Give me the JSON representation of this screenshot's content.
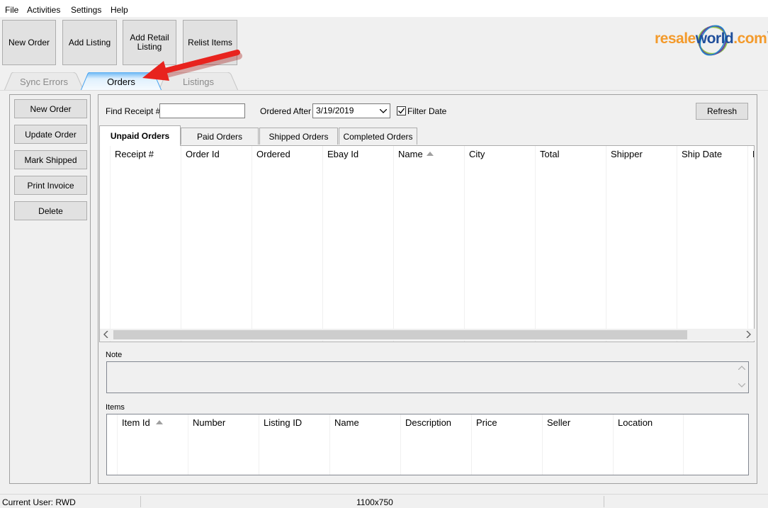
{
  "menu": {
    "file": "File",
    "activities": "Activities",
    "settings": "Settings",
    "help": "Help"
  },
  "toolbar": {
    "new_order": "New Order",
    "add_listing": "Add Listing",
    "add_retail_listing_line1": "Add Retail",
    "add_retail_listing_line2": "Listing",
    "relist_items": "Relist Items"
  },
  "logo": {
    "resale": "resale",
    "world": "world",
    "com": ".com",
    "tm": "™",
    "colors": {
      "resale": "#f39a2b",
      "world": "#1f4e9b",
      "com": "#f39a2b"
    }
  },
  "top_tabs": {
    "sync_errors": "Sync Errors",
    "orders": "Orders",
    "listings": "Listings",
    "active_color": "#47a3f0"
  },
  "sidebar": {
    "new_order": "New Order",
    "update_order": "Update Order",
    "mark_shipped": "Mark Shipped",
    "print_invoice": "Print Invoice",
    "delete": "Delete"
  },
  "filters": {
    "find_receipt_label": "Find Receipt #",
    "find_receipt_value": "",
    "ordered_after_label": "Ordered After",
    "ordered_after_value": "3/19/2019",
    "filter_date_label": "Filter Date",
    "filter_date_checked": true,
    "refresh": "Refresh"
  },
  "order_tabs": {
    "unpaid": "Unpaid Orders",
    "paid": "Paid Orders",
    "shipped": "Shipped Orders",
    "completed": "Completed Orders"
  },
  "orders_grid": {
    "columns": [
      "Receipt #",
      "Order Id",
      "Ordered",
      "Ebay Id",
      "Name",
      "City",
      "Total",
      "Shipper",
      "Ship Date",
      "E"
    ],
    "sorted_column": "Name",
    "rows": []
  },
  "note": {
    "label": "Note",
    "value": ""
  },
  "items": {
    "label": "Items",
    "columns": [
      "Item Id",
      "Number",
      "Listing ID",
      "Name",
      "Description",
      "Price",
      "Seller",
      "Location"
    ],
    "sorted_column": "Item Id",
    "rows": []
  },
  "status": {
    "current_user": "Current User: RWD",
    "size": "1100x750"
  },
  "annotation": {
    "arrow_color": "#e8231e"
  }
}
